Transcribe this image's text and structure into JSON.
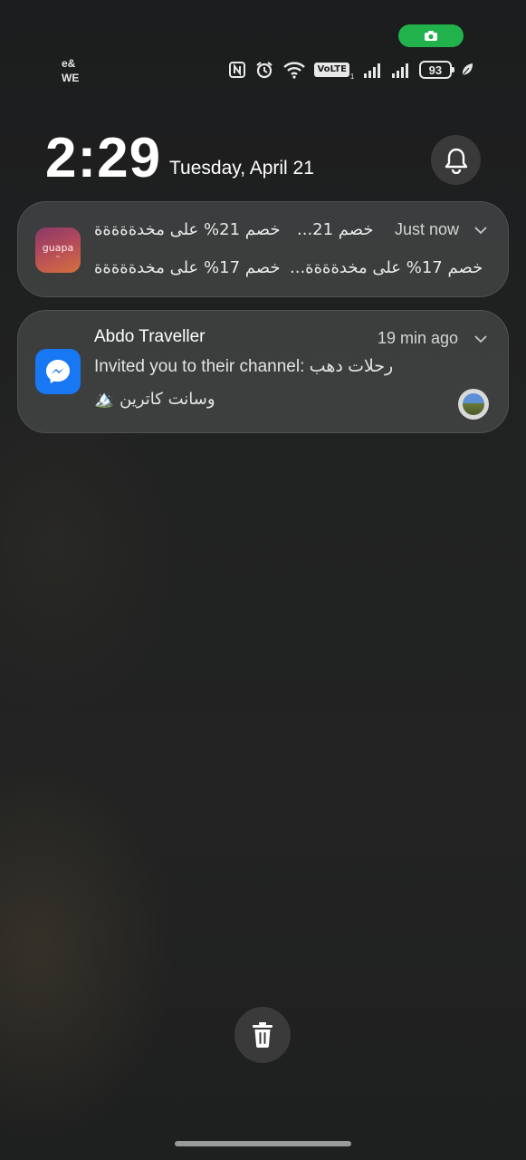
{
  "status_bar": {
    "carrier_line1": "e&",
    "carrier_line2": "WE",
    "volte_label": "VoLTE",
    "volte_sub": "1",
    "battery_level": "93",
    "icons": [
      "nfc-icon",
      "alarm-icon",
      "wifi-icon",
      "volte-icon",
      "signal-icon",
      "signal-icon",
      "battery-icon",
      "leaf-icon"
    ],
    "recording_pill_color": "#22b24c"
  },
  "lockscreen": {
    "time": "2:29",
    "date": "Tuesday, April 21"
  },
  "notifications": [
    {
      "app_icon_text": "guapa",
      "line1_left": "خصم 21% على مخدةةةةة",
      "line1_right": "خصم 21...",
      "line2_left": "خصم 17% على مخدةةةةة",
      "line2_right": "خصم 17% على مخدةةةة...",
      "time": "Just now"
    },
    {
      "app": "messenger",
      "sender": "Abdo Traveller",
      "message_line1": "Invited you to their channel: رحلات دهب",
      "message_line2": "وسانت كاترين 🏔️",
      "time": "19 min ago"
    }
  ],
  "colors": {
    "messenger_blue": "#1877f2",
    "card_bg": "#48494a",
    "button_bg": "#3a3a3b"
  }
}
